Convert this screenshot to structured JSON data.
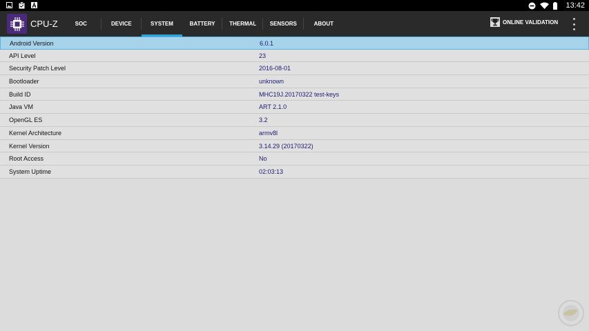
{
  "status_bar": {
    "time": "13:42",
    "icons_left": [
      "image-icon",
      "clipboard-icon",
      "font-icon"
    ],
    "icons_right": [
      "do-not-disturb-icon",
      "wifi-icon",
      "battery-icon"
    ]
  },
  "app": {
    "title": "CPU-Z",
    "accent_color": "#2da4d9"
  },
  "tabs": [
    {
      "label": "SOC",
      "active": false
    },
    {
      "label": "DEVICE",
      "active": false
    },
    {
      "label": "SYSTEM",
      "active": true
    },
    {
      "label": "BATTERY",
      "active": false
    },
    {
      "label": "THERMAL",
      "active": false
    },
    {
      "label": "SENSORS",
      "active": false
    },
    {
      "label": "ABOUT",
      "active": false
    }
  ],
  "toolbar": {
    "online_validation_label": "ONLINE VALIDATION"
  },
  "system_info": [
    {
      "label": "Android Version",
      "value": "6.0.1",
      "selected": true
    },
    {
      "label": "API Level",
      "value": "23"
    },
    {
      "label": "Security Patch Level",
      "value": "2016-08-01"
    },
    {
      "label": "Bootloader",
      "value": "unknown"
    },
    {
      "label": "Build ID",
      "value": "MHC19J.20170322 test-keys"
    },
    {
      "label": "Java VM",
      "value": "ART 2.1.0"
    },
    {
      "label": "OpenGL ES",
      "value": "3.2"
    },
    {
      "label": "Kernel Architecture",
      "value": "armv8l"
    },
    {
      "label": "Kernel Version",
      "value": "3.14.29 (20170322)"
    },
    {
      "label": "Root Access",
      "value": "No"
    },
    {
      "label": "System Uptime",
      "value": "02:03:13"
    }
  ]
}
